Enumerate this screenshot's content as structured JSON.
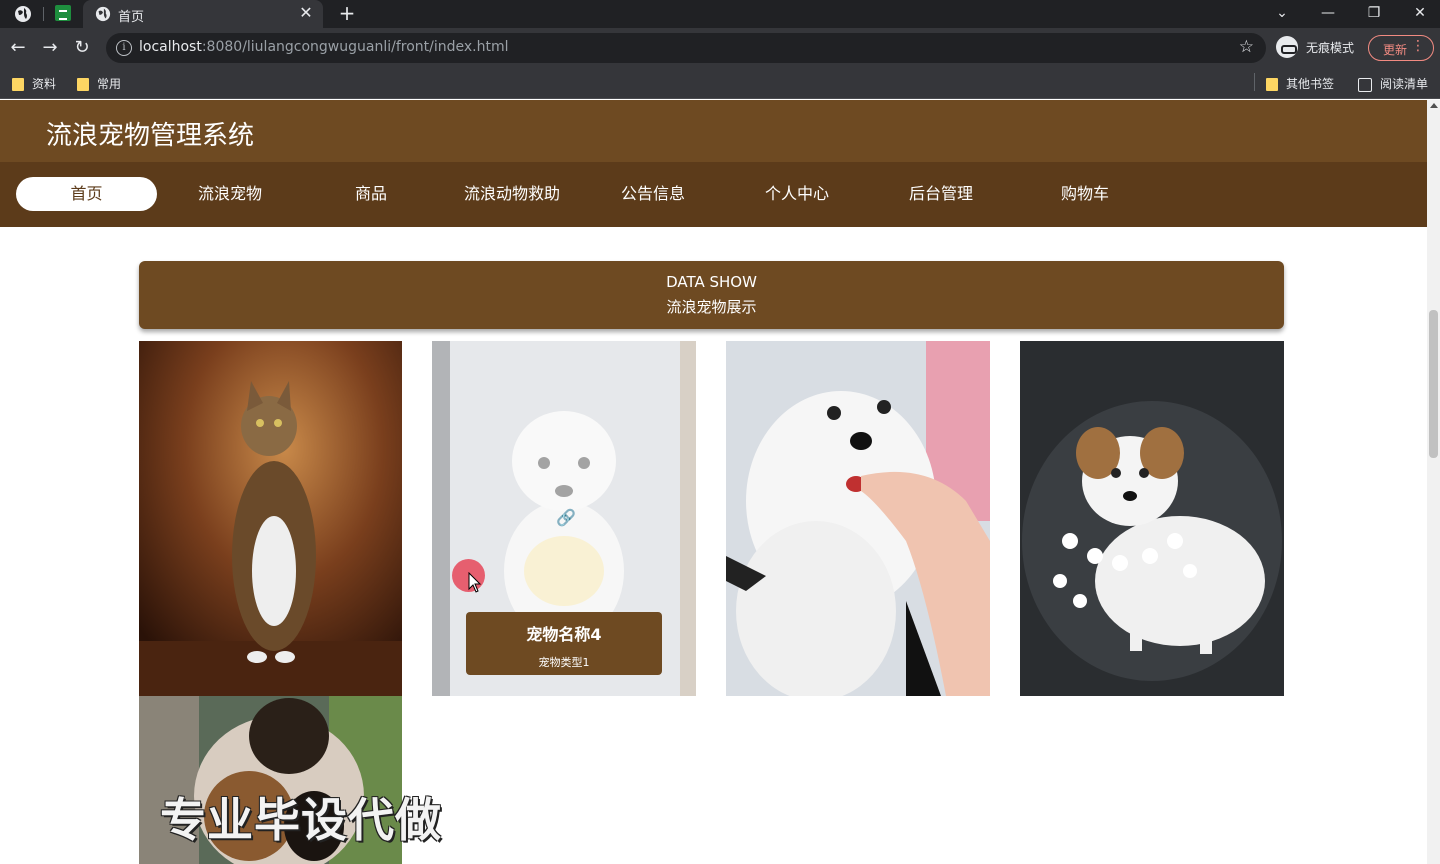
{
  "browser": {
    "tab_title": "首页",
    "url_host": "localhost",
    "url_rest": ":8080/liulangcongwuguanli/front/index.html",
    "incognito_label": "无痕模式",
    "update_label": "更新",
    "bookmarks": [
      "资料",
      "常用"
    ],
    "other_bookmarks": "其他书签",
    "reading_list": "阅读清单"
  },
  "site": {
    "title": "流浪宠物管理系统",
    "nav": [
      "首页",
      "流浪宠物",
      "商品",
      "流浪动物救助",
      "公告信息",
      "个人中心",
      "后台管理",
      "购物车"
    ],
    "active_nav_index": 0
  },
  "section": {
    "title_en": "DATA SHOW",
    "title_zh": "流浪宠物展示"
  },
  "hover_card": {
    "name": "宠物名称4",
    "type": "宠物类型1"
  },
  "watermark": "专业毕设代做",
  "colors": {
    "header": "#6e4a22",
    "nav": "#5c3b1a",
    "chrome_dark": "#202124",
    "chrome_toolbar": "#35363a"
  }
}
